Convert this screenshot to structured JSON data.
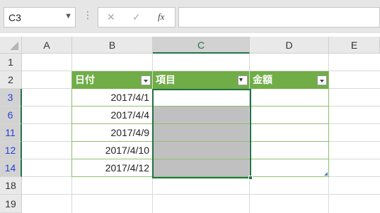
{
  "formula_bar": {
    "name_box": "C3",
    "cancel": "✕",
    "enter": "✓",
    "fx": "fx",
    "value": ""
  },
  "columns": [
    "A",
    "B",
    "C",
    "D",
    "E"
  ],
  "rows": [
    "1",
    "2",
    "3",
    "6",
    "11",
    "12",
    "14",
    "18",
    "19"
  ],
  "table": {
    "headers": [
      "日付",
      "項目",
      "金額"
    ],
    "dates": [
      "2017/4/1",
      "2017/4/4",
      "2017/4/9",
      "2017/4/10",
      "2017/4/12"
    ]
  },
  "colors": {
    "header_green": "#70ad47",
    "selection": "#217346",
    "filtered_row": "#2743d4"
  }
}
